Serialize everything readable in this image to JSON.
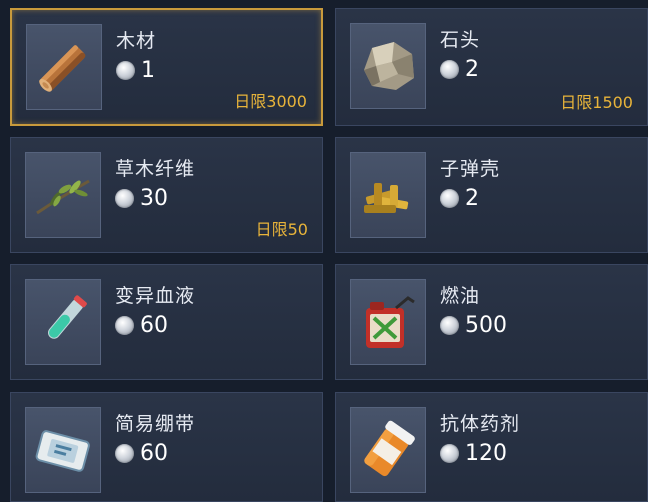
{
  "shop": {
    "items": [
      {
        "name": "木材",
        "price": "1",
        "limit": "日限3000",
        "icon": "wood-log-icon",
        "selected": true
      },
      {
        "name": "石头",
        "price": "2",
        "limit": "日限1500",
        "icon": "stone-icon",
        "selected": false
      },
      {
        "name": "草木纤维",
        "price": "30",
        "limit": "日限50",
        "icon": "plant-fiber-icon",
        "selected": false
      },
      {
        "name": "子弹壳",
        "price": "2",
        "limit": "",
        "icon": "bullet-casing-icon",
        "selected": false
      },
      {
        "name": "变异血液",
        "price": "60",
        "limit": "",
        "icon": "syringe-vial-icon",
        "selected": false
      },
      {
        "name": "燃油",
        "price": "500",
        "limit": "",
        "icon": "fuel-can-icon",
        "selected": false
      },
      {
        "name": "简易绷带",
        "price": "60",
        "limit": "",
        "icon": "bandage-icon",
        "selected": false
      },
      {
        "name": "抗体药剂",
        "price": "120",
        "limit": "",
        "icon": "pill-bottle-icon",
        "selected": false
      }
    ]
  },
  "colors": {
    "limit_text": "#e8b43a",
    "selected_border": "#c89a3c"
  }
}
